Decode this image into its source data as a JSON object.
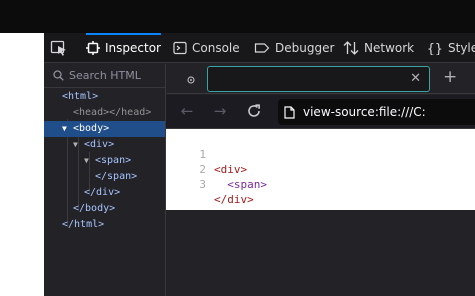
{
  "devtools": {
    "tabs": [
      {
        "label": "Inspector",
        "icon": "inspector-icon",
        "active": true
      },
      {
        "label": "Console",
        "icon": "console-icon"
      },
      {
        "label": "Debugger",
        "icon": "debugger-icon"
      },
      {
        "label": "Network",
        "icon": "network-icon"
      },
      {
        "label": "Style",
        "icon": "style-editor-icon"
      }
    ],
    "search_placeholder": "Search HTML",
    "tree": {
      "html_open": "<html>",
      "head": "<head></head>",
      "body_open": "<body>",
      "div_open": "<div>",
      "span_open": "<span>",
      "span_close": "</span>",
      "div_close": "</div>",
      "body_close": "</body>",
      "html_close": "</html>"
    },
    "filter_value": "",
    "filter_clear": "✕",
    "add_rule": "+"
  },
  "browser": {
    "url": "view-source:file:///C:",
    "source_lines": [
      {
        "n": "1",
        "text": "<div>"
      },
      {
        "n": "2",
        "text": "  <span>"
      },
      {
        "n": "3",
        "text": "</div>"
      }
    ]
  },
  "colors": {
    "accent": "#0a84ff",
    "selected_row": "#204e8a",
    "filter_border": "#3aa3a3",
    "tag_red": "#a41b1b",
    "tag_purple": "#7a2aa0"
  }
}
